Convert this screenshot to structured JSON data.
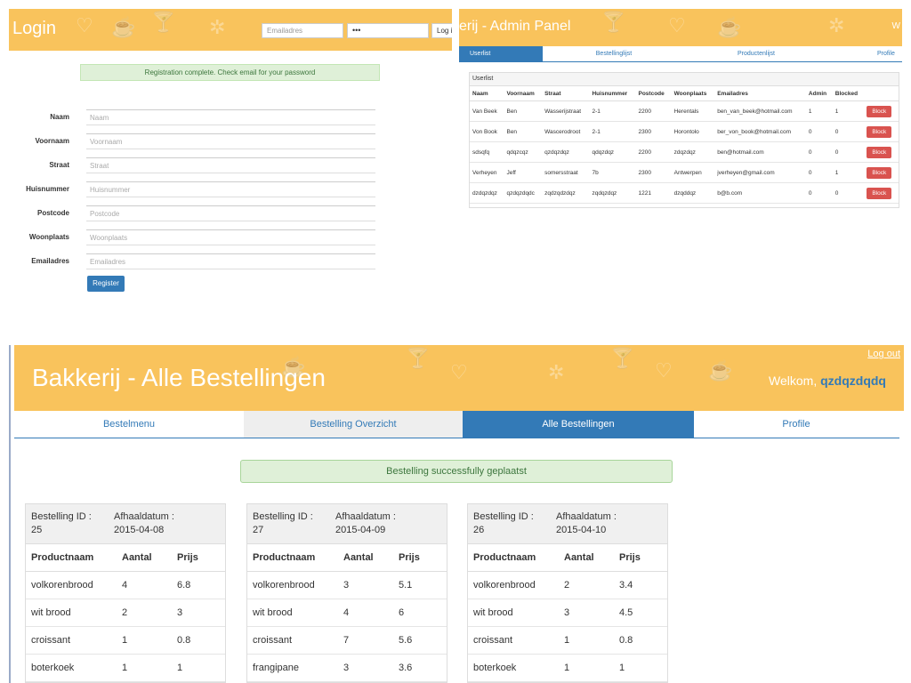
{
  "login": {
    "title": "Login",
    "email_placeholder": "Emailadres",
    "password_value": "•••",
    "login_button": "Log i",
    "alert": "Registration complete. Check email for your password",
    "fields": [
      {
        "label": "Naam",
        "placeholder": "Naam"
      },
      {
        "label": "Voornaam",
        "placeholder": "Voornaam"
      },
      {
        "label": "Straat",
        "placeholder": "Straat"
      },
      {
        "label": "Huisnummer",
        "placeholder": "Huisnummer"
      },
      {
        "label": "Postcode",
        "placeholder": "Postcode"
      },
      {
        "label": "Woonplaats",
        "placeholder": "Woonplaats"
      },
      {
        "label": "Emailadres",
        "placeholder": "Emailadres"
      }
    ],
    "register_button": "Register"
  },
  "admin": {
    "title": "erij - Admin Panel",
    "top_right": "W",
    "tabs": [
      "Userlist",
      "Bestellinglijst",
      "Productenlijst",
      "Profile"
    ],
    "panel_title": "Userlist",
    "columns": [
      "Naam",
      "Voornaam",
      "Straat",
      "Huisnummer",
      "Postcode",
      "Woonplaats",
      "Emailadres",
      "Admin",
      "Blocked"
    ],
    "block_label": "Block",
    "rows": [
      [
        "Van Beek",
        "Ben",
        "Wasserijstraat",
        "2-1",
        "2200",
        "Herentals",
        "ben_van_beek@hotmail.com",
        "1",
        "1"
      ],
      [
        "Von Book",
        "Ben",
        "Wascerodroot",
        "2-1",
        "2300",
        "Horontolo",
        "ber_von_book@hotmail.com",
        "0",
        "0"
      ],
      [
        "sdsqfq",
        "qdqzcqz",
        "qzdqzdqz",
        "qdqzdqz",
        "2200",
        "zdqzdqz",
        "ben@hotmail.com",
        "0",
        "0"
      ],
      [
        "Verheyen",
        "Jeff",
        "somersstraat",
        "7b",
        "2300",
        "Antwerpen",
        "jverheyen@gmail.com",
        "0",
        "1"
      ],
      [
        "dzdqzdqz",
        "qzdqzdqdc",
        "zqdzqdzdqz",
        "zqdqzdqz",
        "1221",
        "dzqddqz",
        "b@b.com",
        "0",
        "0"
      ]
    ]
  },
  "orders_page": {
    "title": "Bakkerij - Alle Bestellingen",
    "logout": "Log out",
    "welcome": "Welkom,",
    "username": "qzdqzdqdq",
    "tabs": [
      "Bestelmenu",
      "Bestelling Overzicht",
      "Alle Bestellingen",
      "Profile"
    ],
    "alert": "Bestelling successfully geplaatst",
    "id_label": "Bestelling ID :",
    "date_label": "Afhaaldatum :",
    "col_product": "Productnaam",
    "col_amount": "Aantal",
    "col_price": "Prijs",
    "orders": [
      {
        "id": "25",
        "date": "2015-04-08",
        "items": [
          [
            "volkorenbrood",
            "4",
            "6.8"
          ],
          [
            "wit brood",
            "2",
            "3"
          ],
          [
            "croissant",
            "1",
            "0.8"
          ],
          [
            "boterkoek",
            "1",
            "1"
          ]
        ]
      },
      {
        "id": "27",
        "date": "2015-04-09",
        "items": [
          [
            "volkorenbrood",
            "3",
            "5.1"
          ],
          [
            "wit brood",
            "4",
            "6"
          ],
          [
            "croissant",
            "7",
            "5.6"
          ],
          [
            "frangipane",
            "3",
            "3.6"
          ]
        ]
      },
      {
        "id": "26",
        "date": "2015-04-10",
        "items": [
          [
            "volkorenbrood",
            "2",
            "3.4"
          ],
          [
            "wit brood",
            "3",
            "4.5"
          ],
          [
            "croissant",
            "1",
            "0.8"
          ],
          [
            "boterkoek",
            "1",
            "1"
          ]
        ]
      }
    ]
  },
  "colors": {
    "banner": "#f9c35c",
    "primary": "#337ab7",
    "danger": "#d9534f",
    "success_bg": "#dff0d8"
  }
}
